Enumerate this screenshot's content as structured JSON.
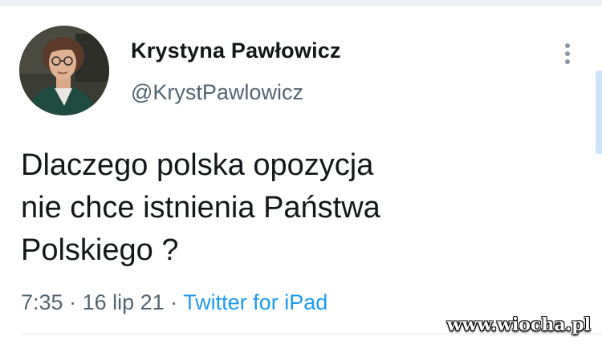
{
  "tweet": {
    "author_name": "Krystyna Pawłowicz",
    "author_handle": "@KrystPawlowicz",
    "text_lines": [
      "Dlaczego polska opozycja",
      "nie chce istnienia Państwa",
      "Polskiego ?"
    ],
    "time": "7:35",
    "separator": " · ",
    "date": "16 lip 21",
    "source": "Twitter for iPad",
    "more_options_icon": "vertical-ellipsis-icon"
  },
  "watermark": {
    "text": "www.wiocha.pl"
  },
  "colors": {
    "link": "#1d9bf0",
    "secondary_text": "#536471",
    "primary_text": "#14171a"
  }
}
